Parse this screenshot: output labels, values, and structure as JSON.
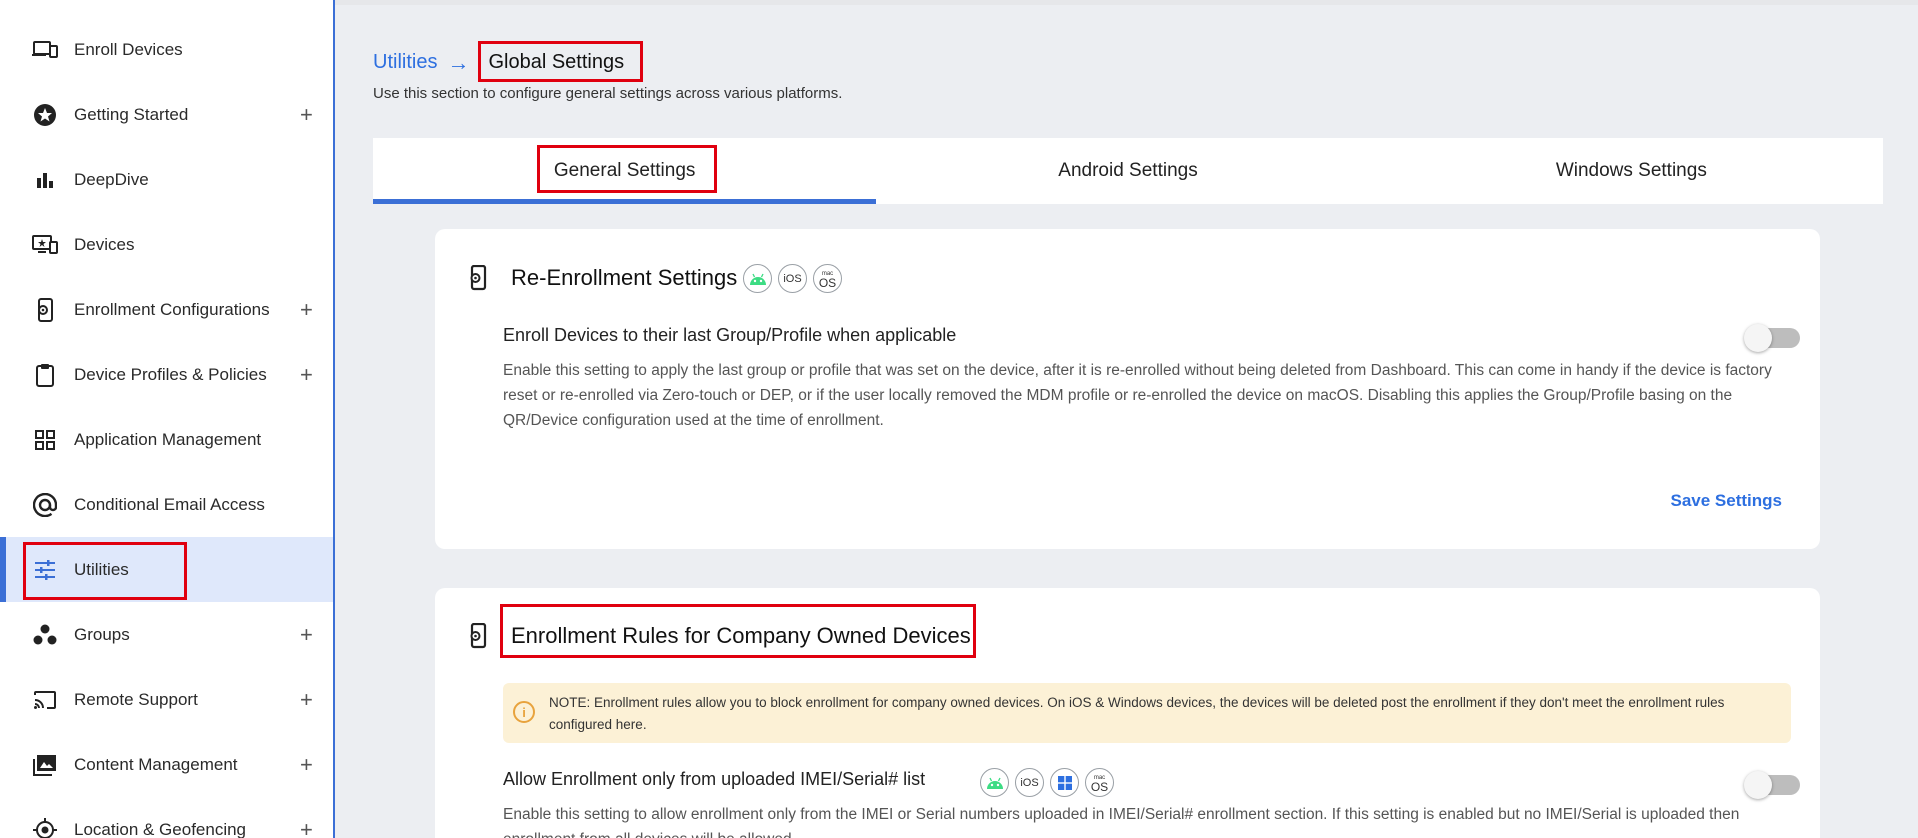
{
  "sidebar": {
    "items": [
      {
        "label": "Enroll Devices",
        "icon": "devices-icon",
        "expandable": false,
        "active": false
      },
      {
        "label": "Getting Started",
        "icon": "star-icon",
        "expandable": true,
        "active": false
      },
      {
        "label": "DeepDive",
        "icon": "bar-chart-icon",
        "expandable": false,
        "active": false
      },
      {
        "label": "Devices",
        "icon": "monitor-icon",
        "expandable": false,
        "active": false
      },
      {
        "label": "Enrollment Configurations",
        "icon": "phone-gear-icon",
        "expandable": true,
        "active": false
      },
      {
        "label": "Device Profiles & Policies",
        "icon": "clipboard-icon",
        "expandable": true,
        "active": false
      },
      {
        "label": "Application Management",
        "icon": "apps-grid-icon",
        "expandable": false,
        "active": false
      },
      {
        "label": "Conditional Email Access",
        "icon": "at-icon",
        "expandable": false,
        "active": false
      },
      {
        "label": "Utilities",
        "icon": "sliders-icon",
        "expandable": false,
        "active": true
      },
      {
        "label": "Groups",
        "icon": "groups-icon",
        "expandable": true,
        "active": false
      },
      {
        "label": "Remote Support",
        "icon": "cast-icon",
        "expandable": true,
        "active": false
      },
      {
        "label": "Content Management",
        "icon": "image-icon",
        "expandable": true,
        "active": false
      },
      {
        "label": "Location & Geofencing",
        "icon": "location-icon",
        "expandable": true,
        "active": false
      }
    ],
    "plus_symbol": "+"
  },
  "breadcrumb": {
    "parent": "Utilities",
    "arrow": "→",
    "current": "Global Settings"
  },
  "subtitle": "Use this section to configure general settings across various platforms.",
  "tabs": [
    {
      "label": "General Settings",
      "active": true
    },
    {
      "label": "Android Settings",
      "active": false
    },
    {
      "label": "Windows Settings",
      "active": false
    }
  ],
  "reenrollment": {
    "title": "Re-Enrollment Settings",
    "badges": [
      "android",
      "iOS",
      "macOS"
    ],
    "setting_title": "Enroll Devices to their last Group/Profile when applicable",
    "setting_desc": "Enable this setting to apply the last group or profile that was set on the device, after it is re-enrolled without being deleted from Dashboard. This can come in handy if the device is factory reset or re-enrolled via Zero-touch or DEP, or if the user locally removed the MDM profile or re-enrolled the device on macOS. Disabling this applies the Group/Profile basing on the QR/Device configuration used at the time of enrollment.",
    "toggle_on": false,
    "save_label": "Save Settings"
  },
  "enrollment_rules": {
    "title": "Enrollment Rules for Company Owned Devices",
    "note_icon": "i",
    "note": "NOTE: Enrollment rules allow you to block enrollment for company owned devices. On iOS & Windows devices, the devices will be deleted post the enrollment if they don't meet the enrollment rules configured here.",
    "setting_title": "Allow Enrollment only from uploaded IMEI/Serial# list",
    "badges": [
      "android",
      "iOS",
      "windows",
      "macOS"
    ],
    "setting_desc": "Enable this setting to allow enrollment only from the IMEI or Serial numbers uploaded in IMEI/Serial# enrollment section. If this setting is enabled but no IMEI/Serial is uploaded then enrollment from all devices will be allowed.",
    "toggle_on": false
  },
  "badge_text": {
    "ios": "iOS",
    "mac_small": "mac",
    "mac_big": "OS"
  },
  "colors": {
    "accent": "#3b6fd6",
    "link": "#2d6fe0",
    "highlight": "#e0000f",
    "note_bg": "#fcf1d6",
    "android_green": "#3ddc84"
  }
}
